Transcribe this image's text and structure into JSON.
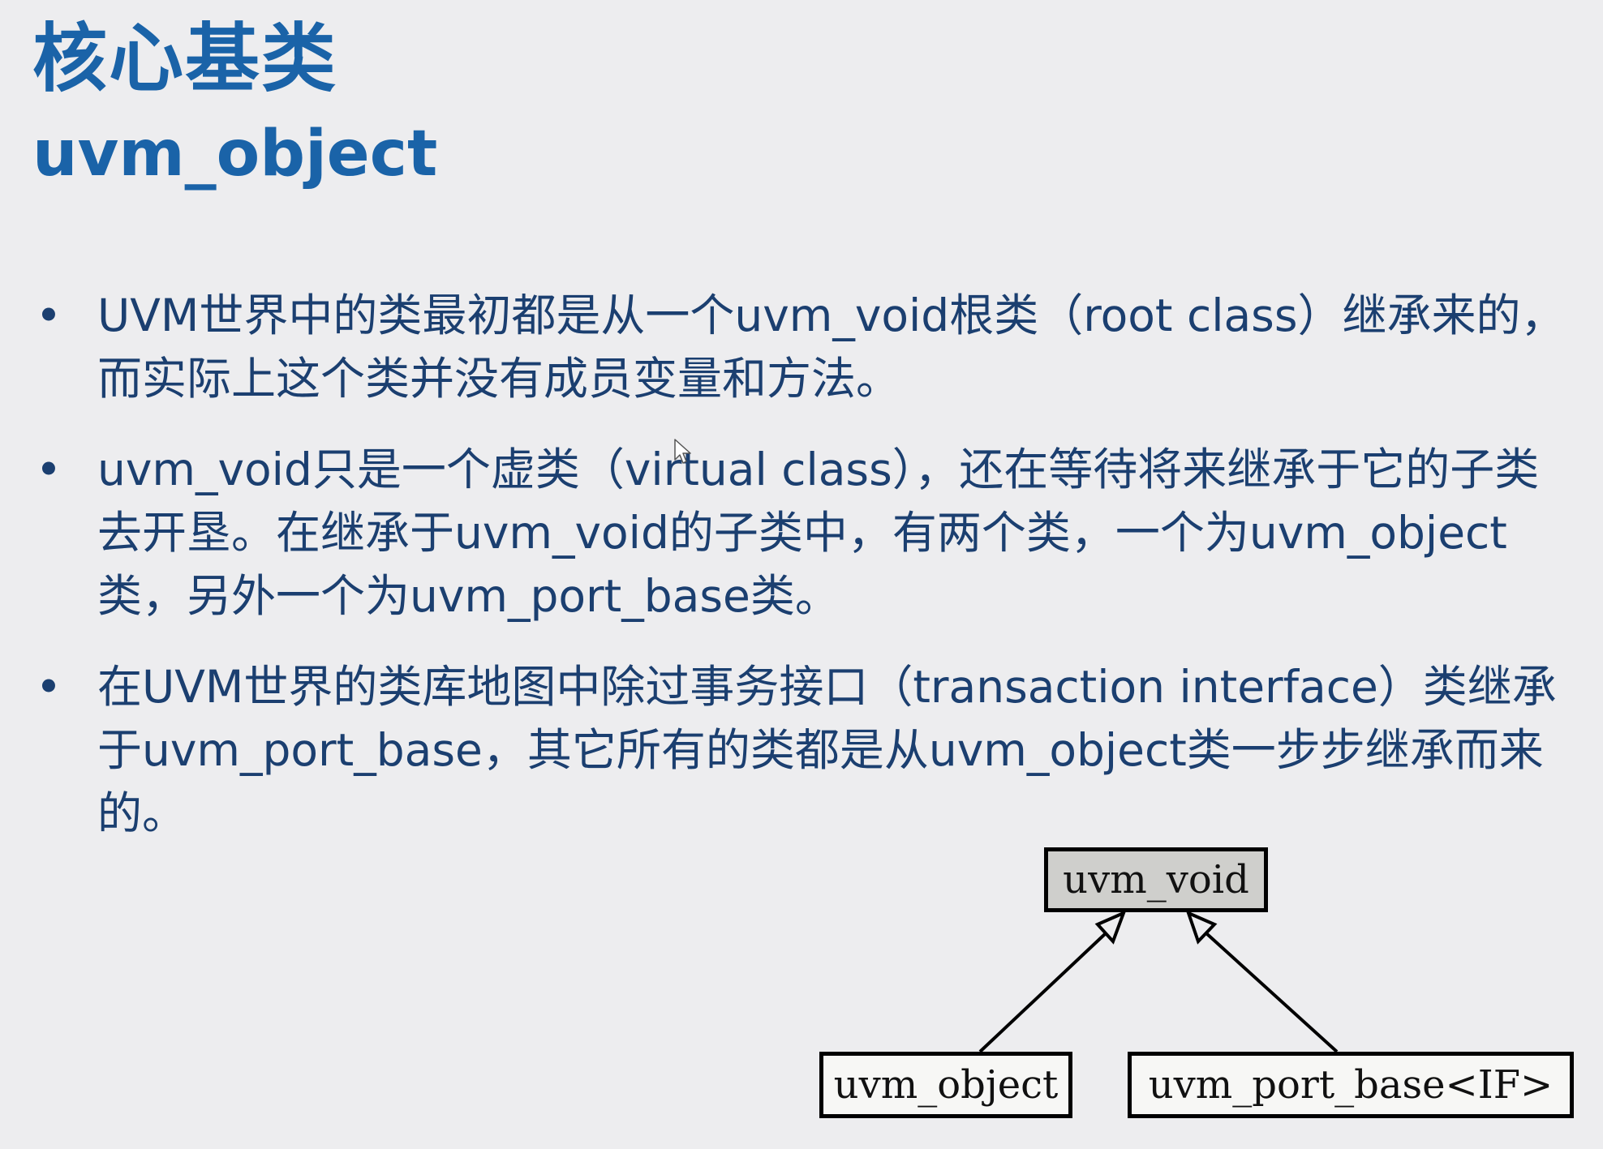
{
  "slide": {
    "title": "核心基类",
    "subtitle": "uvm_object",
    "bullets": [
      {
        "text": "UVM世界中的类最初都是从一个uvm_void根类（root class）继承来的，而实际上这个类并没有成员变量和方法。"
      },
      {
        "text": "uvm_void只是一个虚类（virtual class），还在等待将来继承于它的子类去开垦。在继承于uvm_void的子类中，有两个类，一个为uvm_object类，另外一个为uvm_port_base类。"
      },
      {
        "text": "在UVM世界的类库地图中除过事务接口（transaction interface）类继承于uvm_port_base，其它所有的类都是从uvm_object类一步步继承而来的。"
      }
    ],
    "bullet_symbol": "•",
    "colors": {
      "title": "#1a63a8",
      "body_text": "#1b3f70",
      "background": "#ededef",
      "root_box_fill": "#cfcfcc"
    }
  },
  "diagram": {
    "root": {
      "label": "uvm_void"
    },
    "children": [
      {
        "label": "uvm_object"
      },
      {
        "label": "uvm_port_base<IF>"
      }
    ],
    "edge_style": "hollow-triangle-arrow"
  },
  "icons": {
    "cursor": "mouse-pointer-icon"
  }
}
